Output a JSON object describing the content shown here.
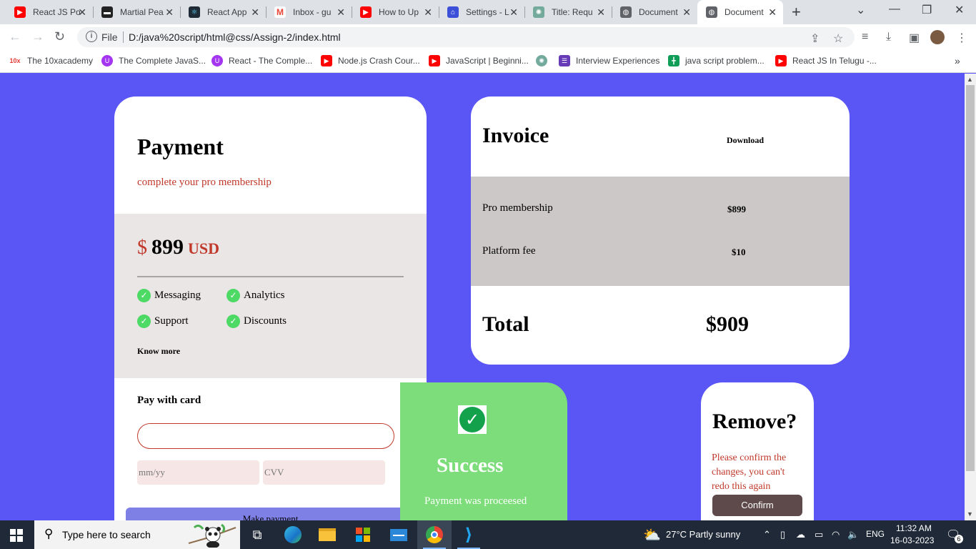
{
  "browser": {
    "tabs": [
      {
        "title": "React JS Po",
        "icon": "youtube-icon",
        "color": "#ff0000"
      },
      {
        "title": "Martial Pea",
        "icon": "film-icon",
        "color": "#222222"
      },
      {
        "title": "React App",
        "icon": "react-icon",
        "color": "#1e2a36"
      },
      {
        "title": "Inbox - gu",
        "icon": "gmail-icon",
        "color": "#ea4335"
      },
      {
        "title": "How to Up",
        "icon": "youtube-icon",
        "color": "#ff0000"
      },
      {
        "title": "Settings - L",
        "icon": "settings-icon",
        "color": "#3c4fd8"
      },
      {
        "title": "Title: Requ",
        "icon": "chatgpt-icon",
        "color": "#74aa9c"
      },
      {
        "title": "Document",
        "icon": "globe-icon",
        "color": "#5f6368"
      },
      {
        "title": "Document",
        "icon": "globe-icon",
        "color": "#5f6368",
        "active": true
      }
    ],
    "address": {
      "scheme": "File",
      "url": "D:/java%20script/html@css/Assign-2/index.html"
    },
    "bookmarks": [
      {
        "label": "The 10xacademy",
        "icon": "10x-icon",
        "color": "#e53935"
      },
      {
        "label": "The Complete JavaS...",
        "icon": "udemy-icon",
        "color": "#a435f0"
      },
      {
        "label": "React - The Comple...",
        "icon": "udemy-icon",
        "color": "#a435f0"
      },
      {
        "label": "Node.js Crash Cour...",
        "icon": "youtube-icon",
        "color": "#ff0000"
      },
      {
        "label": "JavaScript | Beginni...",
        "icon": "youtube-icon",
        "color": "#ff0000"
      },
      {
        "label": "",
        "icon": "chatgpt-icon",
        "color": "#74aa9c"
      },
      {
        "label": "Interview Experiences",
        "icon": "list-icon",
        "color": "#673ab7"
      },
      {
        "label": "java script problem...",
        "icon": "sheets-icon",
        "color": "#0f9d58"
      },
      {
        "label": "React JS In Telugu -...",
        "icon": "youtube-icon",
        "color": "#ff0000"
      }
    ]
  },
  "payment": {
    "title": "Payment",
    "subtitle": "complete your pro membership",
    "currency_symbol": "$",
    "amount": "899",
    "currency": "USD",
    "features": [
      "Messaging",
      "Analytics",
      "Support",
      "Discounts"
    ],
    "know_more": "Know more",
    "pay_with_card": "Pay with card",
    "card_placeholder": "",
    "expiry_placeholder": "mm/yy",
    "cvv_placeholder": "CVV",
    "button": "Make payment"
  },
  "invoice": {
    "title": "Invoice",
    "download": "Download",
    "items": [
      {
        "label": "Pro membership",
        "value": "$899"
      },
      {
        "label": "Platform fee",
        "value": "$10"
      }
    ],
    "total_label": "Total",
    "total_value": "$909"
  },
  "success": {
    "title": "Success",
    "message": "Payment was proceesed"
  },
  "remove": {
    "title": "Remove?",
    "message": "Please confirm the changes, you can't redo this again",
    "button": "Confirm"
  },
  "taskbar": {
    "search_placeholder": "Type here to search",
    "weather": "27°C  Partly sunny",
    "language": "ENG",
    "time": "11:32 AM",
    "date": "16-03-2023",
    "notifications": "6"
  },
  "colors": {
    "page_bg": "#5a55f5",
    "accent_red": "#c0392b",
    "success_bg": "#7ddd7a",
    "invoice_rows": "#ccc8c8"
  }
}
